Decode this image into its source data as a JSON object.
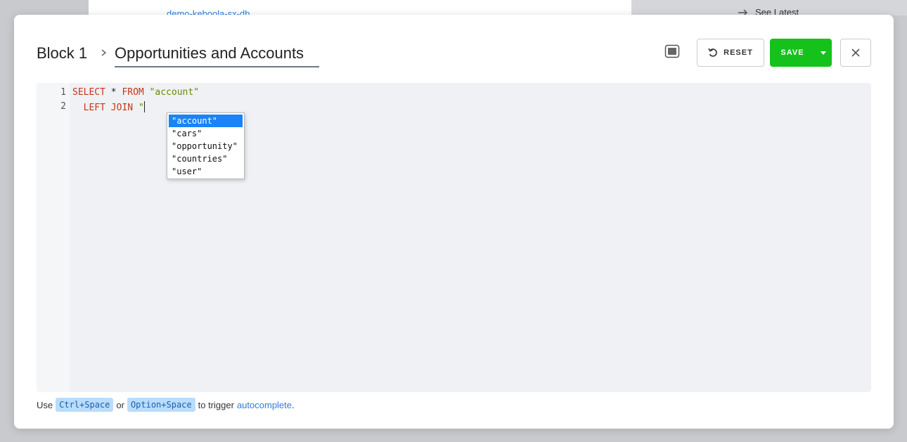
{
  "background": {
    "link_text": "demo-keboola-sx-db",
    "see_latest": "See Latest"
  },
  "header": {
    "block_label": "Block 1",
    "title": "Opportunities and Accounts",
    "reset_label": "RESET",
    "save_label": "SAVE"
  },
  "editor": {
    "lines": [
      {
        "number": "1",
        "tokens": [
          {
            "text": "SELECT",
            "kind": "keyword"
          },
          {
            "text": " * ",
            "kind": "plain"
          },
          {
            "text": "FROM",
            "kind": "keyword"
          },
          {
            "text": " ",
            "kind": "plain"
          },
          {
            "text": "\"account\"",
            "kind": "string"
          }
        ]
      },
      {
        "number": "2",
        "tokens": [
          {
            "text": "  ",
            "kind": "plain"
          },
          {
            "text": "LEFT JOIN",
            "kind": "keyword"
          },
          {
            "text": " ",
            "kind": "plain"
          },
          {
            "text": "\"",
            "kind": "string"
          }
        ]
      }
    ],
    "autocomplete": {
      "selected_index": 0,
      "items": [
        "\"account\"",
        "\"cars\"",
        "\"opportunity\"",
        "\"countries\"",
        "\"user\""
      ]
    }
  },
  "footer": {
    "use_text": "Use",
    "shortcut_1": "Ctrl+Space",
    "or_text": "or",
    "shortcut_2": "Option+Space",
    "to_trigger_text": "to trigger",
    "link_text": "autocomplete",
    "period": "."
  },
  "colors": {
    "accent": "#15c21c",
    "link": "#2b7de0",
    "keyword": "#c8351a",
    "string": "#6a8a00",
    "selection": "#1a84f6"
  },
  "icons": {
    "breadcrumb_separator": "chevron-right-icon",
    "fullscreen": "fullscreen-toggle-icon",
    "reset": "undo-icon",
    "save_dropdown": "caret-down-icon",
    "close": "close-icon"
  }
}
